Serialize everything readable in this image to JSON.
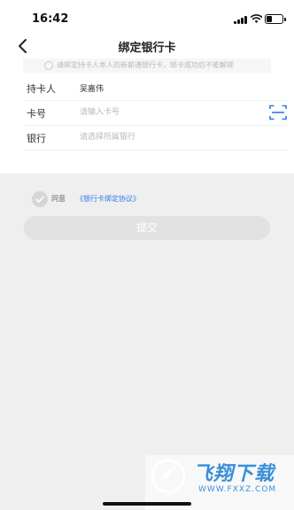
{
  "status_bar": {
    "time": "16:42"
  },
  "nav": {
    "title": "绑定银行卡",
    "back_icon": "chevron-left-icon"
  },
  "notice": {
    "text": "请绑定持卡人本人的新薪通银行卡，绑卡成功后不能解绑",
    "icon": "info-icon"
  },
  "form": {
    "holder": {
      "label": "持卡人",
      "value": "吴嘉伟"
    },
    "card_number": {
      "label": "卡号",
      "placeholder": "请输入卡号",
      "scan_icon": "scan-icon"
    },
    "bank": {
      "label": "银行",
      "placeholder": "请选择所属银行"
    }
  },
  "agreement": {
    "prefix": "同意",
    "link": "《银行卡绑定协议》",
    "checked": false
  },
  "submit": {
    "label": "提交",
    "enabled": false
  },
  "watermark": {
    "title": "飞翔下载",
    "url": "WWW.FXXZ.COM"
  },
  "colors": {
    "link": "#2e7be6",
    "scan_icon": "#2e7be6",
    "watermark": "#3a8fd8",
    "button_disabled": "#e2e2e2",
    "page_background": "#efefef"
  }
}
